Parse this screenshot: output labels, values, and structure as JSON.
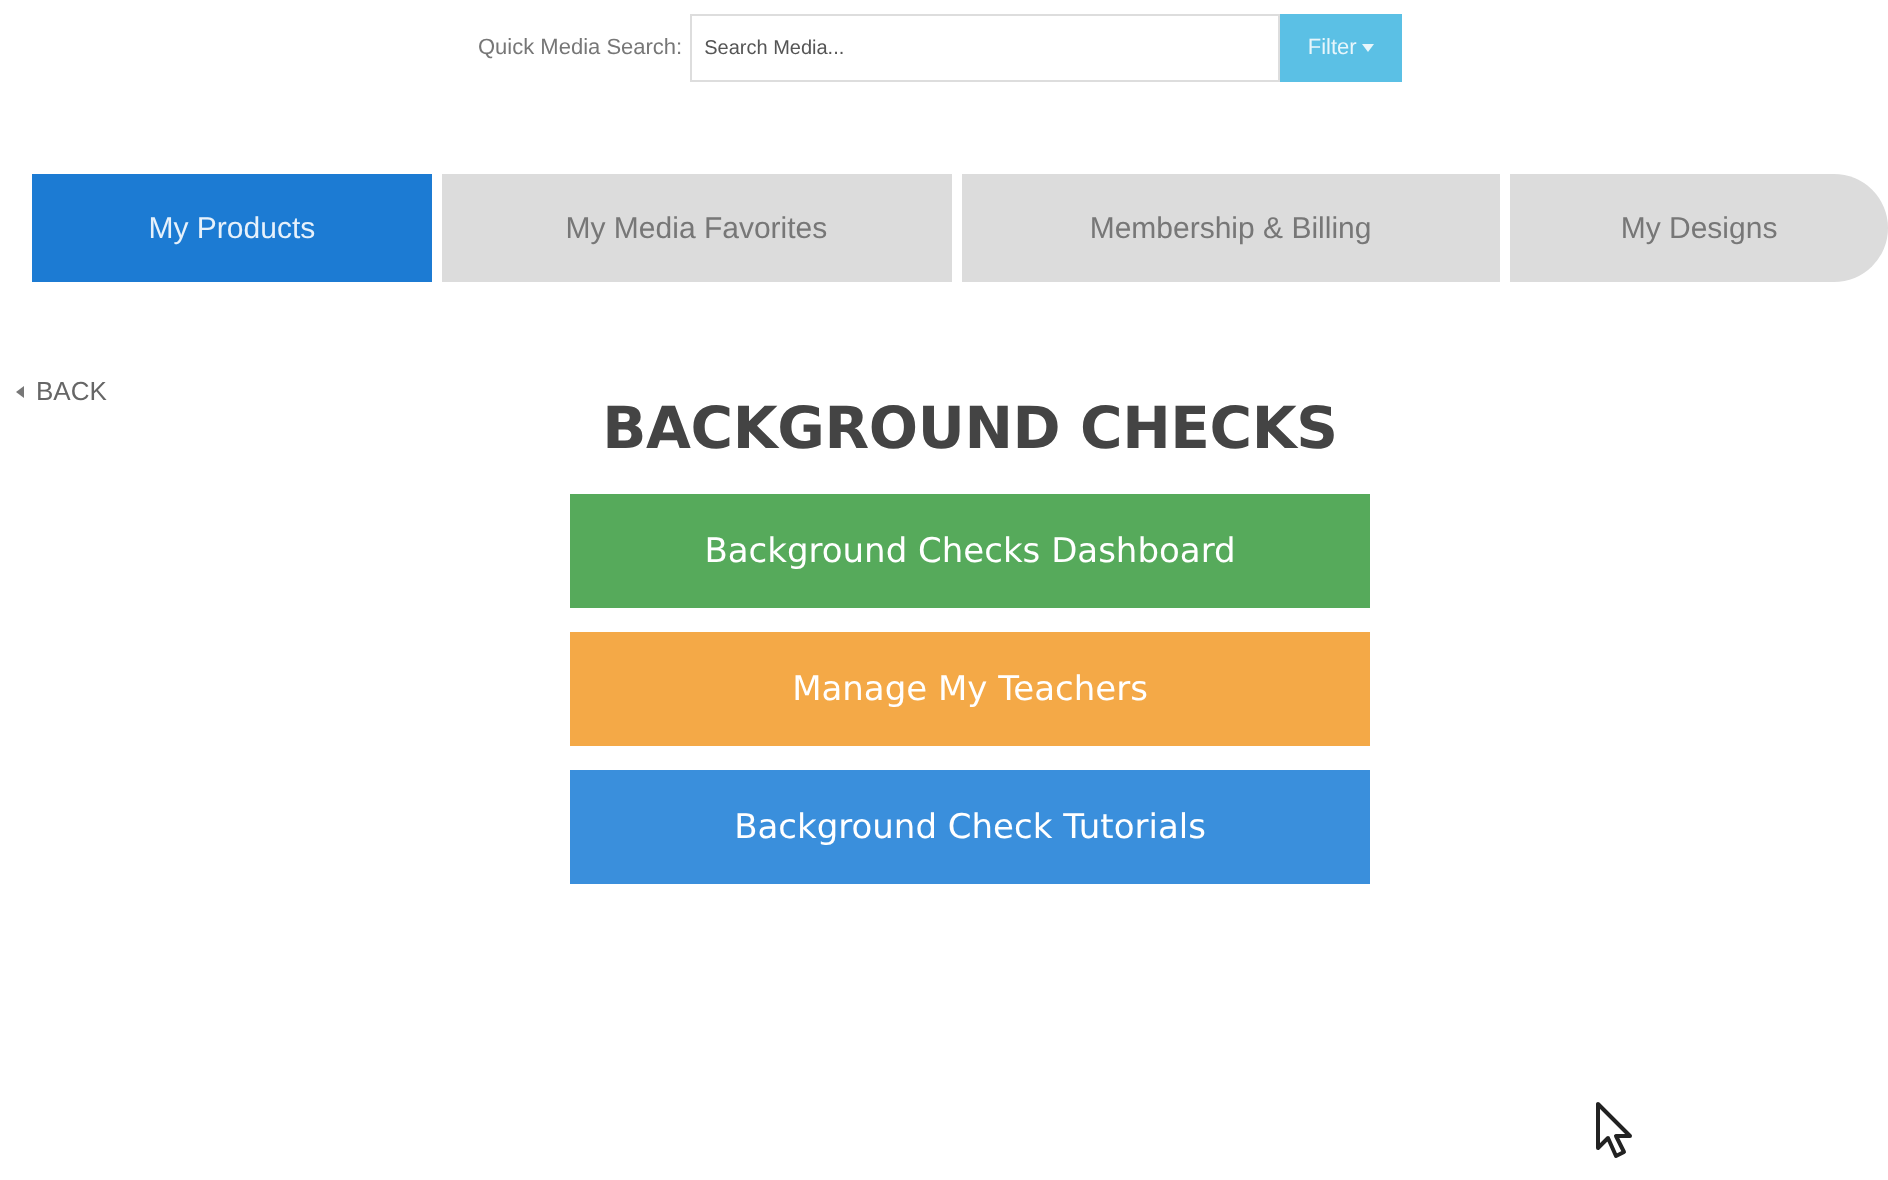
{
  "search": {
    "label": "Quick Media Search:",
    "placeholder": "Search Media...",
    "button": "Filter"
  },
  "tabs": [
    {
      "label": "My Products",
      "selected": true
    },
    {
      "label": "My Media Favorites",
      "selected": false
    },
    {
      "label": "Membership & Billing",
      "selected": false
    },
    {
      "label": "My Designs",
      "selected": false
    }
  ],
  "back_link": "BACK",
  "heading": "BACKGROUND CHECKS",
  "buttons": [
    {
      "label": "Background Checks Dashboard",
      "color": "#56aa5b"
    },
    {
      "label": "Manage My Teachers",
      "color": "#f4a947"
    },
    {
      "label": "Background Check Tutorials",
      "color": "#3a8fdc"
    }
  ]
}
